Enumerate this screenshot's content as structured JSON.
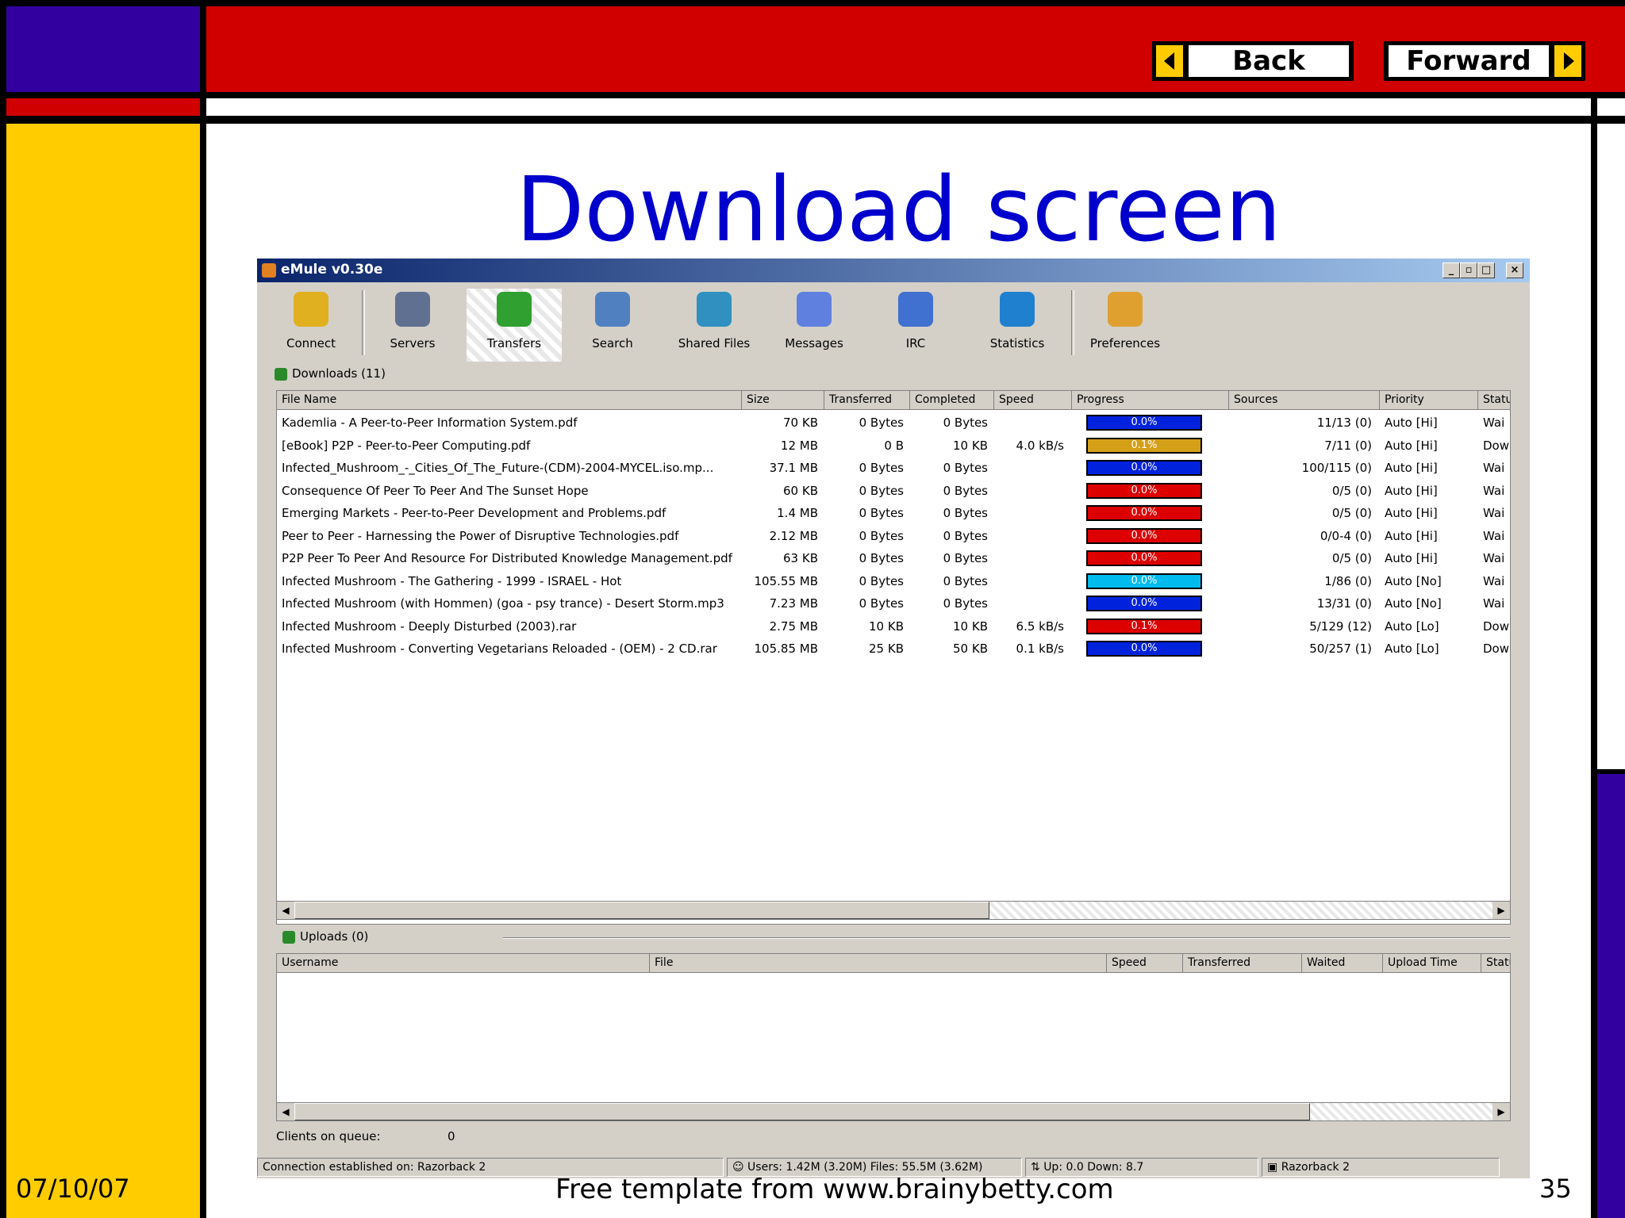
{
  "slide": {
    "title": "Download screen",
    "back_label": "Back",
    "forward_label": "Forward",
    "date": "07/10/07",
    "footer": "Free template from www.brainybetty.com",
    "page_number": "35",
    "colors": {
      "purple": "#3300a0",
      "red": "#d10000",
      "yellow": "#ffcc00",
      "title_blue": "#0000cc"
    }
  },
  "window": {
    "title": "eMule v0.30e",
    "toolbar": [
      "Connect",
      "Servers",
      "Transfers",
      "Search",
      "Shared Files",
      "Messages",
      "IRC",
      "Statistics",
      "Preferences"
    ],
    "downloads_header": "Downloads (11)",
    "download_columns": [
      "File Name",
      "Size",
      "Transferred",
      "Completed",
      "Speed",
      "Progress",
      "Sources",
      "Priority",
      "Status"
    ],
    "downloads": [
      {
        "name": "Kademlia - A Peer-to-Peer Information System.pdf",
        "size": "70 KB",
        "transferred": "0 Bytes",
        "completed": "0 Bytes",
        "speed": "",
        "progress": "0.0%",
        "sources": "11/13 (0)",
        "priority": "Auto [Hi]",
        "status": "Wai",
        "bar_color": "#0022dd"
      },
      {
        "name": "[eBook] P2P - Peer-to-Peer Computing.pdf",
        "size": "12 MB",
        "transferred": "0 B",
        "completed": "10 KB",
        "speed": "4.0 kB/s",
        "progress": "0.1%",
        "sources": "7/11 (0)",
        "priority": "Auto [Hi]",
        "status": "Dow",
        "bar_color": "#d4a017"
      },
      {
        "name": "Infected_Mushroom_-_Cities_Of_The_Future-(CDM)-2004-MYCEL.iso.mp...",
        "size": "37.1 MB",
        "transferred": "0 Bytes",
        "completed": "0 Bytes",
        "speed": "",
        "progress": "0.0%",
        "sources": "100/115 (0)",
        "priority": "Auto [Hi]",
        "status": "Wai",
        "bar_color": "#0022dd"
      },
      {
        "name": "Consequence Of Peer To Peer And The Sunset Hope",
        "size": "60 KB",
        "transferred": "0 Bytes",
        "completed": "0 Bytes",
        "speed": "",
        "progress": "0.0%",
        "sources": "0/5 (0)",
        "priority": "Auto [Hi]",
        "status": "Wai",
        "bar_color": "#dd0000"
      },
      {
        "name": "Emerging Markets - Peer-to-Peer Development and Problems.pdf",
        "size": "1.4 MB",
        "transferred": "0 Bytes",
        "completed": "0 Bytes",
        "speed": "",
        "progress": "0.0%",
        "sources": "0/5 (0)",
        "priority": "Auto [Hi]",
        "status": "Wai",
        "bar_color": "#dd0000"
      },
      {
        "name": "Peer to Peer - Harnessing the Power of Disruptive Technologies.pdf",
        "size": "2.12 MB",
        "transferred": "0 Bytes",
        "completed": "0 Bytes",
        "speed": "",
        "progress": "0.0%",
        "sources": "0/0-4 (0)",
        "priority": "Auto [Hi]",
        "status": "Wai",
        "bar_color": "#dd0000"
      },
      {
        "name": "P2P Peer To Peer And Resource For Distributed Knowledge Management.pdf",
        "size": "63 KB",
        "transferred": "0 Bytes",
        "completed": "0 Bytes",
        "speed": "",
        "progress": "0.0%",
        "sources": "0/5 (0)",
        "priority": "Auto [Hi]",
        "status": "Wai",
        "bar_color": "#dd0000"
      },
      {
        "name": "Infected Mushroom - The Gathering - 1999 - ISRAEL - Hot",
        "size": "105.55 MB",
        "transferred": "0 Bytes",
        "completed": "0 Bytes",
        "speed": "",
        "progress": "0.0%",
        "sources": "1/86 (0)",
        "priority": "Auto [No]",
        "status": "Wai",
        "bar_color": "#00bbee"
      },
      {
        "name": "Infected Mushroom (with Hommen) (goa - psy trance) - Desert Storm.mp3",
        "size": "7.23 MB",
        "transferred": "0 Bytes",
        "completed": "0 Bytes",
        "speed": "",
        "progress": "0.0%",
        "sources": "13/31 (0)",
        "priority": "Auto [No]",
        "status": "Wai",
        "bar_color": "#0022dd"
      },
      {
        "name": "Infected Mushroom - Deeply Disturbed (2003).rar",
        "size": "2.75 MB",
        "transferred": "10 KB",
        "completed": "10 KB",
        "speed": "6.5 kB/s",
        "progress": "0.1%",
        "sources": "5/129 (12)",
        "priority": "Auto [Lo]",
        "status": "Dow",
        "bar_color": "#dd0000"
      },
      {
        "name": "Infected Mushroom - Converting Vegetarians Reloaded - (OEM) - 2 CD.rar",
        "size": "105.85 MB",
        "transferred": "25 KB",
        "completed": "50 KB",
        "speed": "0.1 kB/s",
        "progress": "0.0%",
        "sources": "50/257 (1)",
        "priority": "Auto [Lo]",
        "status": "Dow",
        "bar_color": "#0022dd"
      }
    ],
    "uploads_header": "Uploads (0)",
    "upload_columns": [
      "Username",
      "File",
      "Speed",
      "Transferred",
      "Waited",
      "Upload Time",
      "Status"
    ],
    "clients_on_queue_label": "Clients on queue:",
    "clients_on_queue_value": "0",
    "status": {
      "connection": "Connection established on: Razorback 2",
      "users_files": "Users: 1.42M (3.20M) Files: 55.5M (3.62M)",
      "updown": "Up: 0.0 Down: 8.7",
      "server": "Razorback 2"
    }
  }
}
